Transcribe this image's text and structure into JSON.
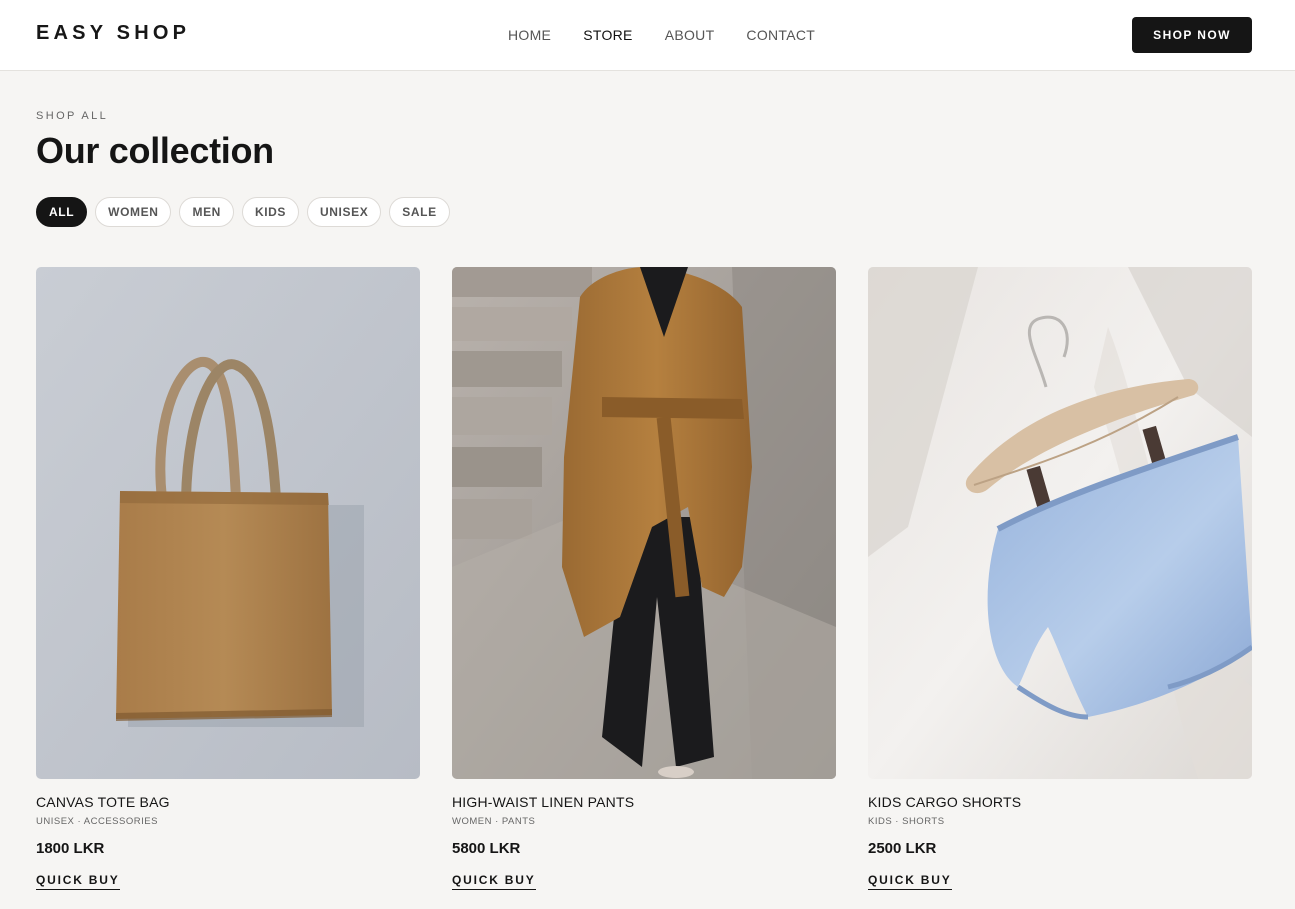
{
  "header": {
    "logo": "EASY SHOP",
    "nav": [
      {
        "label": "HOME",
        "active": false
      },
      {
        "label": "STORE",
        "active": true
      },
      {
        "label": "ABOUT",
        "active": false
      },
      {
        "label": "CONTACT",
        "active": false
      }
    ],
    "cta": "SHOP NOW"
  },
  "main": {
    "eyebrow": "SHOP ALL",
    "title": "Our collection",
    "filters": [
      {
        "label": "ALL",
        "active": true
      },
      {
        "label": "WOMEN",
        "active": false
      },
      {
        "label": "MEN",
        "active": false
      },
      {
        "label": "KIDS",
        "active": false
      },
      {
        "label": "UNISEX",
        "active": false
      },
      {
        "label": "SALE",
        "active": false
      }
    ],
    "products": [
      {
        "name": "CANVAS TOTE BAG",
        "meta": "UNISEX · ACCESSORIES",
        "price": "1800 LKR",
        "action": "QUICK BUY"
      },
      {
        "name": "HIGH-WAIST LINEN PANTS",
        "meta": "WOMEN · PANTS",
        "price": "5800 LKR",
        "action": "QUICK BUY"
      },
      {
        "name": "KIDS CARGO SHORTS",
        "meta": "KIDS · SHORTS",
        "price": "2500 LKR",
        "action": "QUICK BUY"
      }
    ]
  },
  "colors": {
    "background": "#f6f5f3",
    "header": "#ffffff",
    "accent": "#151515"
  }
}
